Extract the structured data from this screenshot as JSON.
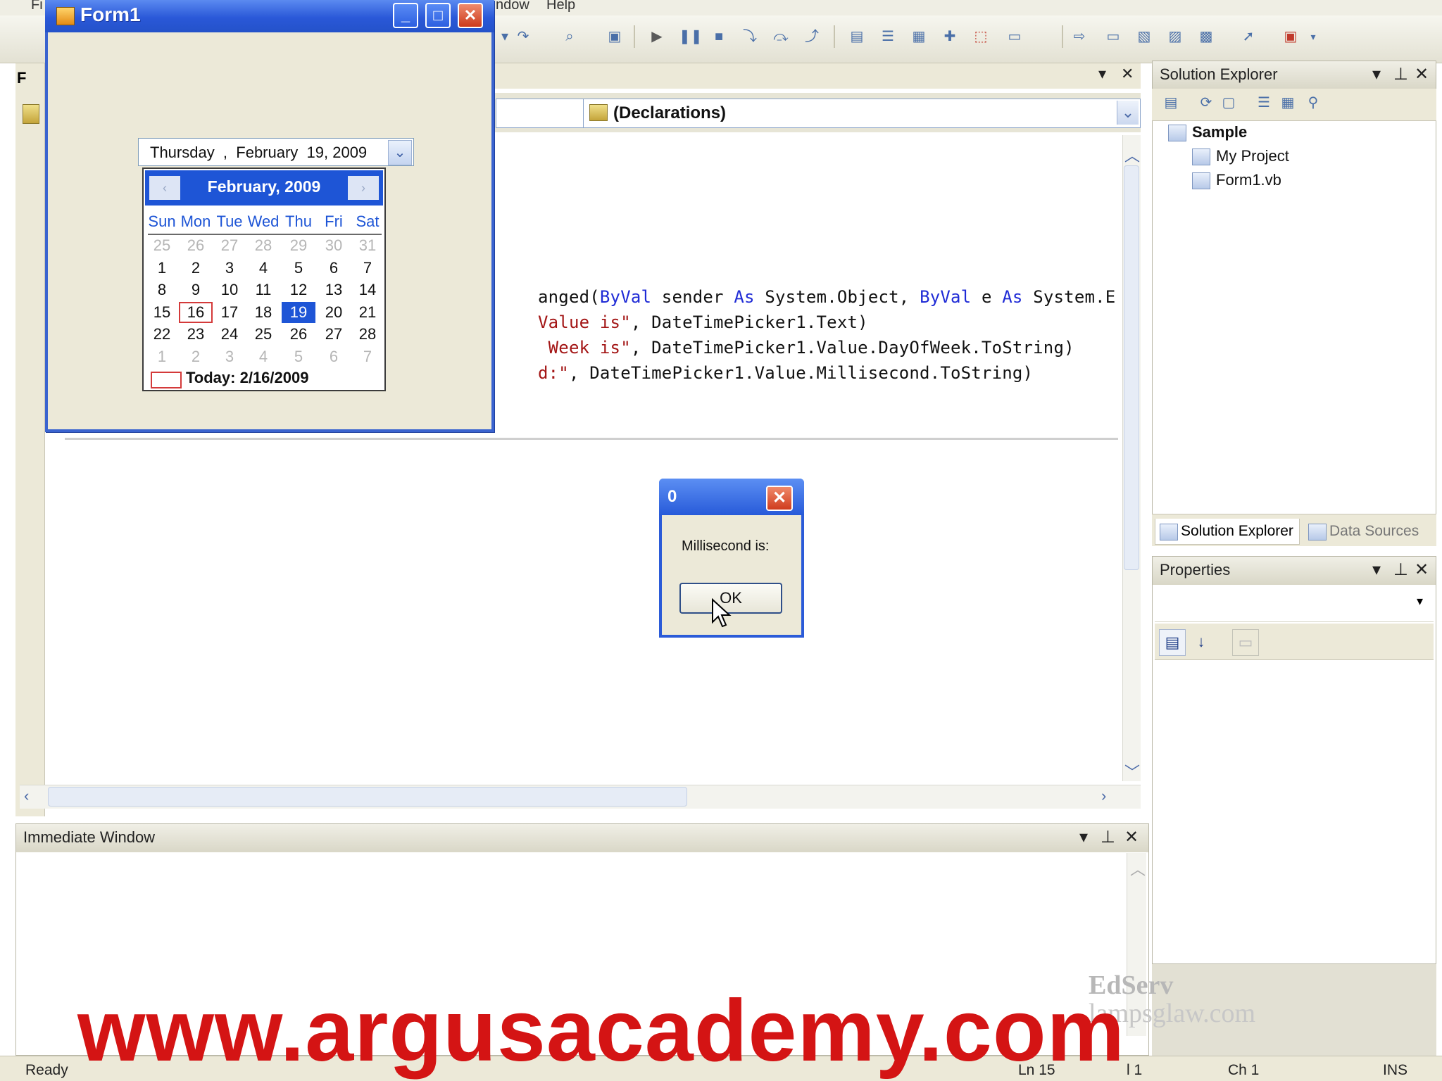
{
  "menubar": {
    "items": [
      "Fi",
      "ndow",
      "Help"
    ]
  },
  "editor": {
    "declarations_label": "(Declarations)",
    "code_lines": [
      {
        "a": "anged(",
        "kw1": "ByVal",
        "b": " sender ",
        "kw2": "As",
        "c": " System.Object, ",
        "kw3": "ByVal",
        "d": " e ",
        "kw4": "As",
        "e": " System.E"
      },
      {
        "str": "Value is\"",
        "rest": ", DateTimePicker1.Text)"
      },
      {
        "str": " Week is\"",
        "rest": ", DateTimePicker1.Value.DayOfWeek.ToString)"
      },
      {
        "str": "d:\"",
        "rest": ", DateTimePicker1.Value.Millisecond.ToString)"
      }
    ]
  },
  "form1": {
    "title": "Form1",
    "picker_text": "Thursday  ,  February  19, 2009",
    "calendar": {
      "title": "February, 2009",
      "dow": [
        "Sun",
        "Mon",
        "Tue",
        "Wed",
        "Thu",
        "Fri",
        "Sat"
      ],
      "weeks": [
        [
          "25",
          "26",
          "27",
          "28",
          "29",
          "30",
          "31"
        ],
        [
          "1",
          "2",
          "3",
          "4",
          "5",
          "6",
          "7"
        ],
        [
          "8",
          "9",
          "10",
          "11",
          "12",
          "13",
          "14"
        ],
        [
          "15",
          "16",
          "17",
          "18",
          "19",
          "20",
          "21"
        ],
        [
          "22",
          "23",
          "24",
          "25",
          "26",
          "27",
          "28"
        ],
        [
          "1",
          "2",
          "3",
          "4",
          "5",
          "6",
          "7"
        ]
      ],
      "selected_day": "19",
      "today_day": "16",
      "today_label": "Today: 2/16/2009"
    }
  },
  "solution_explorer": {
    "title": "Solution Explorer",
    "tree": [
      "Sample",
      "My Project",
      "Form1.vb"
    ],
    "tabs": [
      "Solution Explorer",
      "Data Sources"
    ]
  },
  "properties": {
    "title": "Properties"
  },
  "immediate": {
    "title": "Immediate Window"
  },
  "msgbox": {
    "title": "0",
    "text": "Millisecond is:",
    "ok_label": "OK"
  },
  "statusbar": {
    "ready": "Ready",
    "ln": "Ln 15",
    "col": "l 1",
    "ch": "Ch 1",
    "ins": "INS"
  },
  "watermark": {
    "url": "www.argusacademy.com",
    "brand": "EdServ",
    "site": "lampsglaw.com"
  },
  "colors": {
    "xp_title_blue": "#2a58d8",
    "watermark_red": "#d41414",
    "calendar_blue": "#1e55d6"
  }
}
